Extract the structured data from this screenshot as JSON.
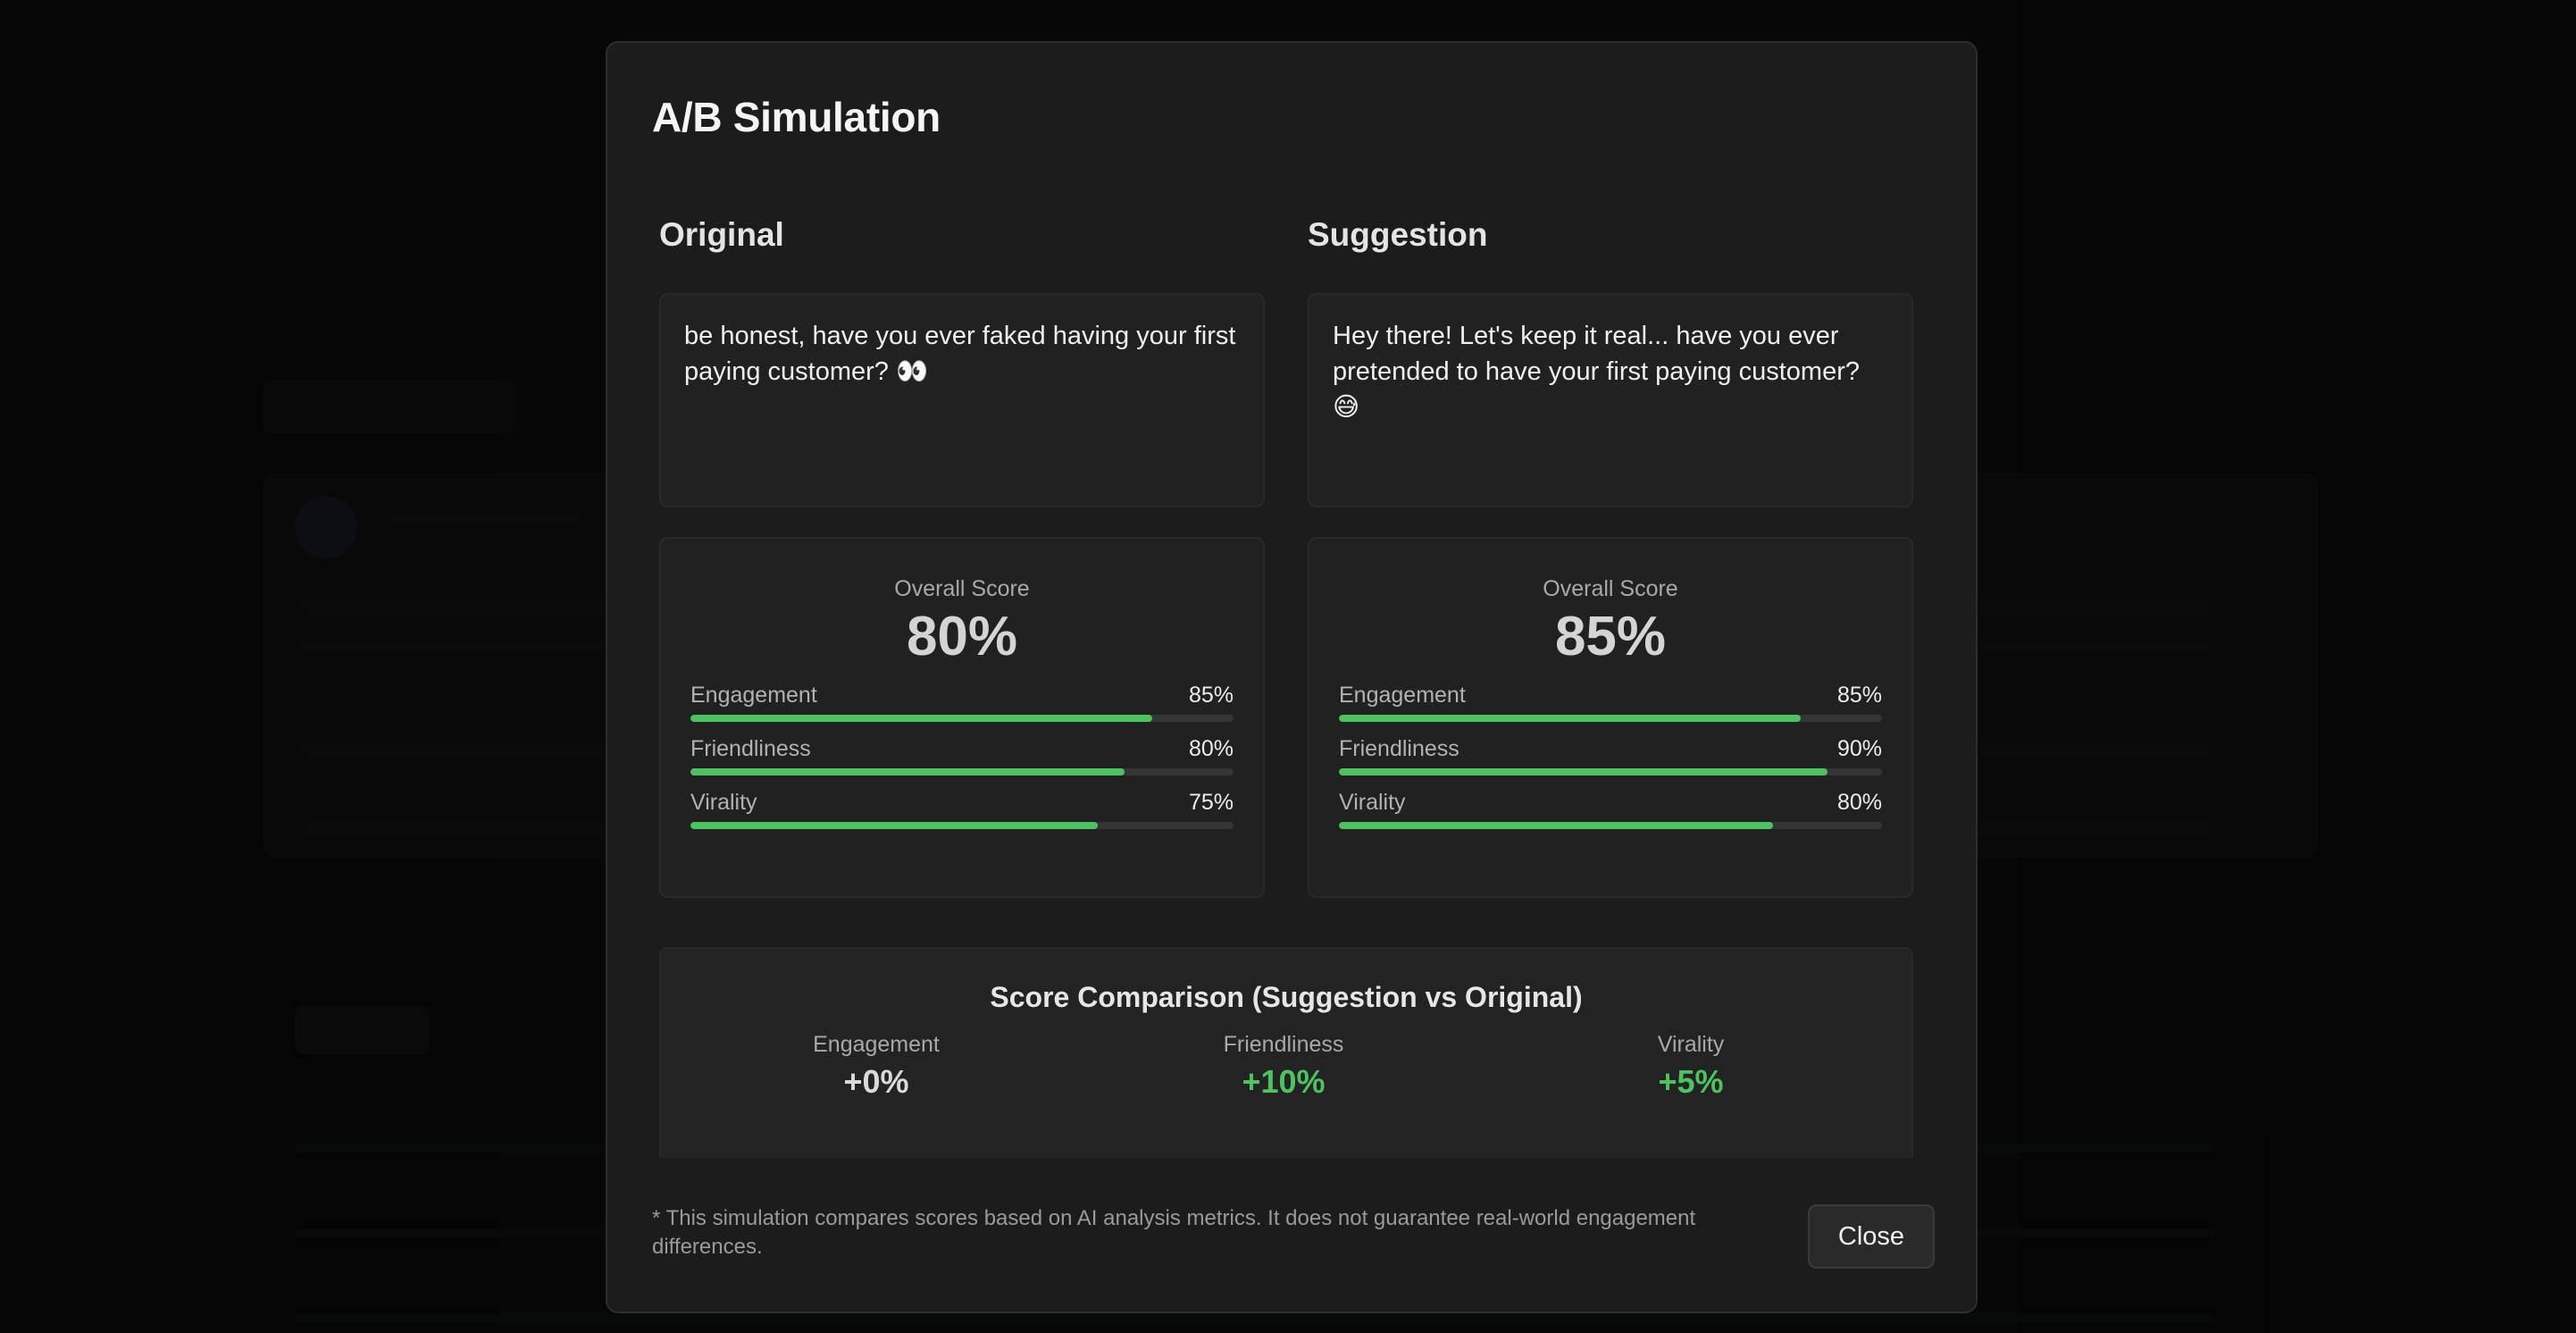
{
  "colors": {
    "accent_green": "#4cc35e",
    "modal_bg": "#1c1c1c",
    "panel_bg": "#212121"
  },
  "modal": {
    "title": "A/B Simulation",
    "original": {
      "heading": "Original",
      "text": "be honest, have you ever faked having your first paying customer? 👀",
      "overall_label": "Overall Score",
      "overall_value": "80%",
      "metrics": [
        {
          "name": "Engagement",
          "value": "85%",
          "fraction": 0.85
        },
        {
          "name": "Friendliness",
          "value": "80%",
          "fraction": 0.8
        },
        {
          "name": "Virality",
          "value": "75%",
          "fraction": 0.75
        }
      ]
    },
    "suggestion": {
      "heading": "Suggestion",
      "text": "Hey there! Let's keep it real... have you ever pretended to have your first paying customer? 😅",
      "overall_label": "Overall Score",
      "overall_value": "85%",
      "metrics": [
        {
          "name": "Engagement",
          "value": "85%",
          "fraction": 0.85
        },
        {
          "name": "Friendliness",
          "value": "90%",
          "fraction": 0.9
        },
        {
          "name": "Virality",
          "value": "80%",
          "fraction": 0.8
        }
      ]
    },
    "comparison": {
      "title": "Score Comparison (Suggestion vs Original)",
      "items": [
        {
          "name": "Engagement",
          "delta": "+0%"
        },
        {
          "name": "Friendliness",
          "delta": "+10%"
        },
        {
          "name": "Virality",
          "delta": "+5%"
        }
      ]
    },
    "footnote": "* This simulation compares scores based on AI analysis metrics. It does not guarantee real-world engagement differences.",
    "close_label": "Close"
  }
}
